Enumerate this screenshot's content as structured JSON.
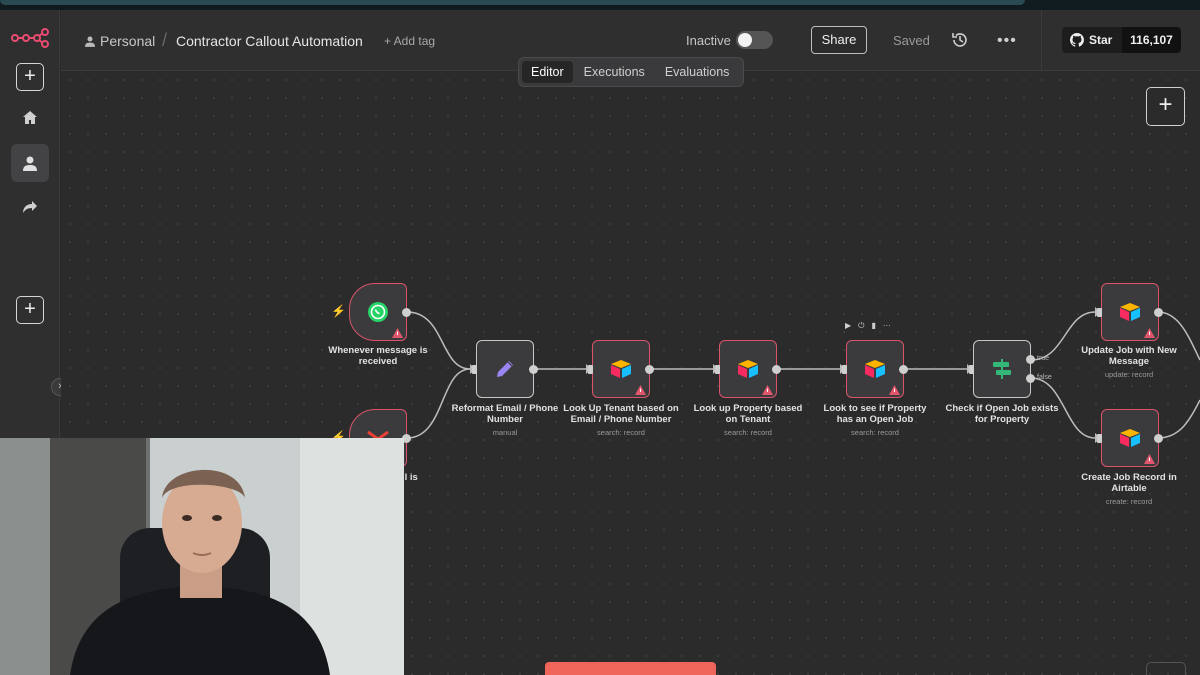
{
  "header": {
    "owner": "Personal",
    "workflow_title": "Contractor Callout Automation",
    "add_tag": "+ Add tag",
    "status_label": "Inactive",
    "share": "Share",
    "saved": "Saved"
  },
  "github": {
    "star_label": "Star",
    "star_count": "116,107"
  },
  "tabs": [
    "Editor",
    "Executions",
    "Evaluations"
  ],
  "active_tab": "Editor",
  "nodes": [
    {
      "id": "whatsapp-trigger",
      "label": "Whenever message is received",
      "sub": "",
      "icon": "whatsapp-icon"
    },
    {
      "id": "email-trigger",
      "label": "il is",
      "sub": "",
      "icon": "gmail-icon"
    },
    {
      "id": "reformat",
      "label": "Reformat Email / Phone Number",
      "sub": "manual",
      "icon": "pencil-icon"
    },
    {
      "id": "lookup-tenant",
      "label": "Look Up Tenant based on Email / Phone Number",
      "sub": "search: record",
      "icon": "airtable-icon"
    },
    {
      "id": "lookup-property",
      "label": "Look up Property based on Tenant",
      "sub": "search: record",
      "icon": "airtable-icon"
    },
    {
      "id": "check-open-job",
      "label": "Look to see if Property has an Open Job",
      "sub": "search: record",
      "icon": "airtable-icon"
    },
    {
      "id": "if-open-job",
      "label": "Check if Open Job exists for Property",
      "sub": "",
      "icon": "if-branch-icon"
    },
    {
      "id": "update-job",
      "label": "Update Job with New Message",
      "sub": "update: record",
      "icon": "airtable-icon"
    },
    {
      "id": "create-job",
      "label": "Create Job Record in Airtable",
      "sub": "create: record",
      "icon": "airtable-icon"
    }
  ],
  "branches": {
    "true": "true",
    "false": "false"
  },
  "colors": {
    "accent": "#ff6d5a",
    "error_border": "#d95468",
    "canvas": "#2b2b2b"
  }
}
